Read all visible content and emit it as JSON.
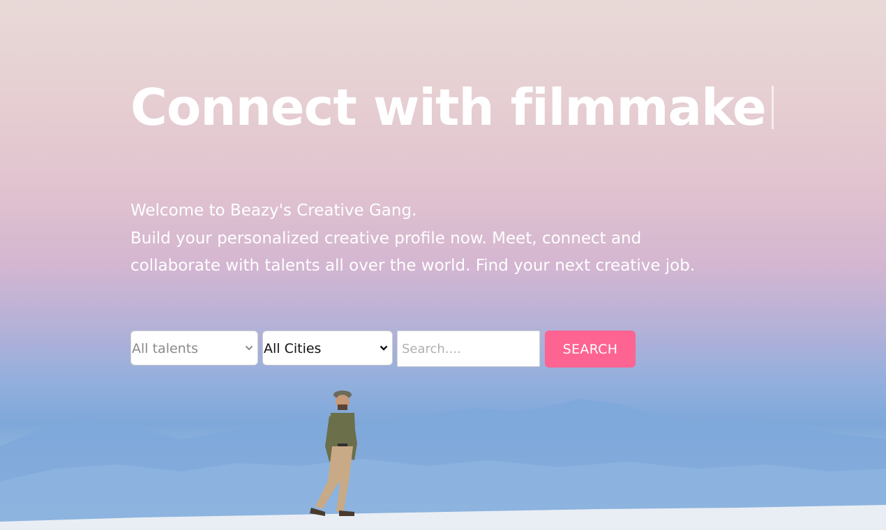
{
  "hero": {
    "headline": "Connect with filmmake",
    "intro_line1": "Welcome to Beazy's Creative Gang.",
    "intro_line2": "Build your personalized creative profile now. Meet, connect and",
    "intro_line3": "collaborate with talents all over the world. Find your next creative job."
  },
  "search": {
    "talents_selected": "All talents",
    "cities_selected": "All Cities",
    "input_placeholder": "Search....",
    "button_label": "SEARCH"
  },
  "colors": {
    "accent": "#fd6492",
    "text_on_hero": "#ffffff"
  },
  "icons": {
    "dropdown": "chevron-down-icon"
  }
}
